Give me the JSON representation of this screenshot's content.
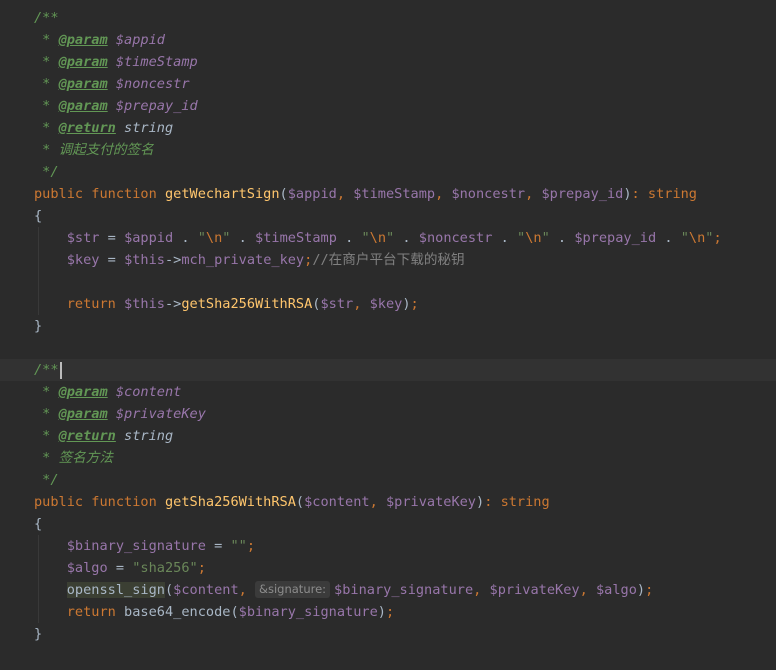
{
  "editor": {
    "block1": {
      "doc_open": "/**",
      "star": " * ",
      "tag_param": "@param",
      "tag_return": "@return",
      "p_appid": "$appid",
      "p_timeStamp": "$timeStamp",
      "p_noncestr": "$noncestr",
      "p_prepay_id": "$prepay_id",
      "ret_type": "string",
      "desc": "调起支付的签名",
      "doc_close": " */",
      "kw_public": "public",
      "kw_function": "function",
      "fn_name": "getWechartSign",
      "a_appid": "$appid",
      "a_timeStamp": "$timeStamp",
      "a_noncestr": "$noncestr",
      "a_prepay_id": "$prepay_id",
      "type_string": "string",
      "brace_open": "{",
      "v_str": "$str",
      "v_appid": "$appid",
      "nl": "\\n",
      "v_timeStamp": "$timeStamp",
      "v_noncestr": "$noncestr",
      "v_prepay_id": "$prepay_id",
      "v_key": "$key",
      "v_this": "$this",
      "prop_key": "mch_private_key",
      "comment": "//在商户平台下载的秘钥",
      "kw_return": "return",
      "call_fn": "getSha256WithRSA",
      "brace_close": "}"
    },
    "block2": {
      "doc_open": "/**",
      "tag_param": "@param",
      "tag_return": "@return",
      "p_content": "$content",
      "p_privateKey": "$privateKey",
      "ret_type": "string",
      "desc": "签名方法",
      "doc_close": " */",
      "kw_public": "public",
      "kw_function": "function",
      "fn_name": "getSha256WithRSA",
      "a_content": "$content",
      "a_privateKey": "$privateKey",
      "type_string": "string",
      "brace_open": "{",
      "v_binary_signature": "$binary_signature",
      "empty_str": "\"\"",
      "v_algo": "$algo",
      "algo_str": "\"sha256\"",
      "openssl_fn": "openssl_sign",
      "hint_signature": "&signature:",
      "kw_return": "return",
      "b64_fn": "base64_encode",
      "brace_close": "}"
    }
  }
}
